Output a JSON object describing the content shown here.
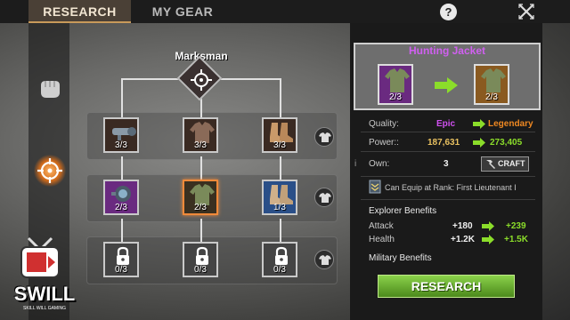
{
  "tabs": [
    {
      "label": "RESEARCH",
      "active": true
    },
    {
      "label": "MY GEAR",
      "active": false
    }
  ],
  "help_label": "?",
  "tree": {
    "title": "Marksman",
    "rows": [
      [
        {
          "name": "scope-gear",
          "level": "3/3",
          "rarity": "gear"
        },
        {
          "name": "jacket",
          "level": "3/3",
          "rarity": "gear"
        },
        {
          "name": "boots",
          "level": "3/3",
          "rarity": "gear"
        }
      ],
      [
        {
          "name": "scope",
          "level": "2/3",
          "rarity": "epic"
        },
        {
          "name": "jacket",
          "level": "2/3",
          "rarity": "selected"
        },
        {
          "name": "boots",
          "level": "1/3",
          "rarity": "rare"
        }
      ],
      [
        {
          "name": "scope",
          "level": "0/3",
          "rarity": "locked"
        },
        {
          "name": "jacket",
          "level": "0/3",
          "rarity": "locked"
        },
        {
          "name": "boots",
          "level": "0/3",
          "rarity": "locked"
        }
      ]
    ]
  },
  "detail": {
    "title": "Hunting Jacket",
    "from_level": "2/3",
    "to_level": "2/3",
    "quality_label": "Quality:",
    "quality_from": "Epic",
    "quality_to": "Legendary",
    "power_label": "Power::",
    "power_from": "187,631",
    "power_to": "273,405",
    "own_label": "Own:",
    "own_value": "3",
    "craft_label": "CRAFT",
    "rank_text": "Can Equip at Rank: First Lieutenant I",
    "explorer_title": "Explorer Benefits",
    "benefits": [
      {
        "label": "Attack",
        "from": "+180",
        "to": "+239"
      },
      {
        "label": "Health",
        "from": "+1.2K",
        "to": "+1.5K"
      }
    ],
    "military_title": "Military Benefits",
    "research_label": "RESEARCH"
  },
  "watermark": {
    "text": "SWILL",
    "sub": "SKILL WILL GAMING"
  },
  "colors": {
    "accent": "#f08a3a",
    "epic": "#d050f0",
    "legendary": "#ee8822",
    "green": "#8bdd2a"
  }
}
